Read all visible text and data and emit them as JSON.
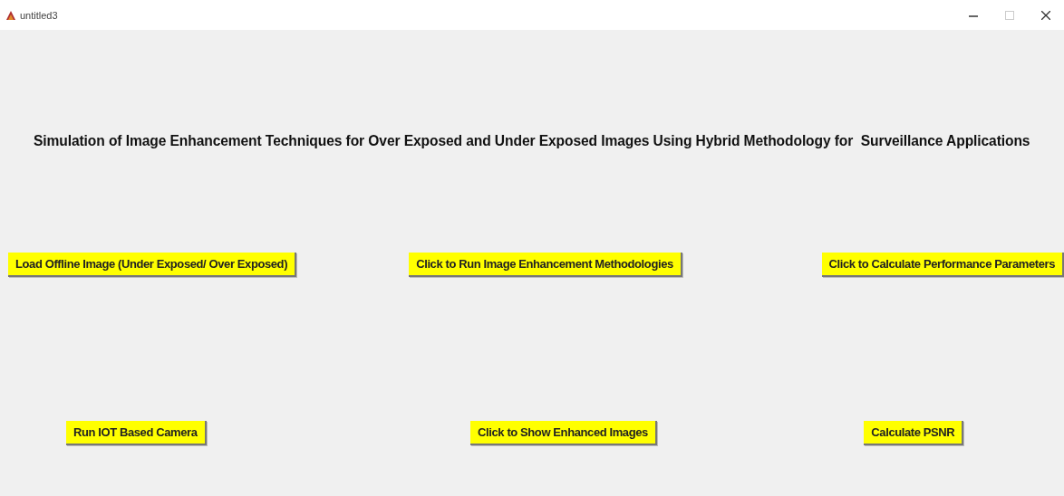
{
  "window": {
    "title": "untitled3"
  },
  "heading": "Simulation of Image Enhancement Techniques for Over Exposed and Under Exposed Images Using Hybrid Methodology for  Surveillance Applications",
  "button_rows": [
    [
      "Load Offline Image (Under Exposed/ Over Exposed)",
      "Click to Run Image Enhancement Methodologies",
      "Click to Calculate Performance Parameters"
    ],
    [
      "Run IOT Based Camera",
      "Click to Show Enhanced Images",
      "Calculate PSNR"
    ]
  ]
}
